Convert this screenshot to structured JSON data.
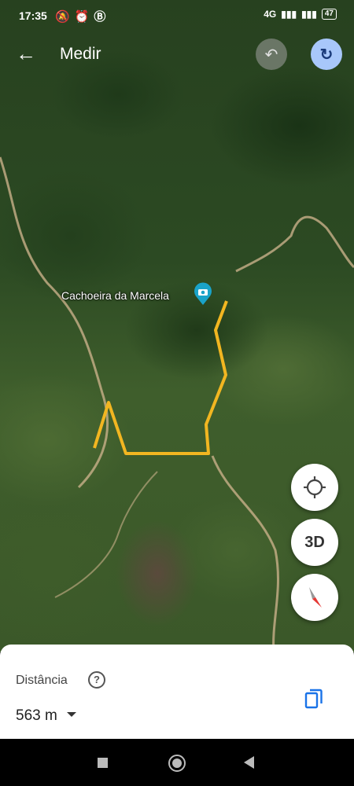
{
  "status_bar": {
    "time": "17:35",
    "left_icons": [
      "mute-bell-icon",
      "alarm-icon",
      "b-icon"
    ],
    "network": "4G",
    "battery": "47"
  },
  "app_bar": {
    "title": "Medir",
    "back_icon": "arrow-left-icon",
    "undo_icon": "undo-icon",
    "redo_icon": "redo-icon"
  },
  "map": {
    "place_label": "Cachoeira da Marcela",
    "place_pin_icon": "camera-pin-icon",
    "measure_line_color": "#f2b621",
    "pin_color": "#1aa3c9"
  },
  "fabs": {
    "location_icon": "crosshair-icon",
    "label_3d": "3D",
    "compass_icon": "compass-icon"
  },
  "bottom_sheet": {
    "distance_label": "Distância",
    "help_icon": "help-icon",
    "distance_value": "563 m",
    "copy_icon": "copy-icon"
  },
  "nav_bar": {
    "items": [
      "recents-square-icon",
      "home-circle-icon",
      "back-triangle-icon"
    ]
  },
  "colors": {
    "accent_blue": "#a8c7fa",
    "copy_blue": "#1a73e8"
  }
}
